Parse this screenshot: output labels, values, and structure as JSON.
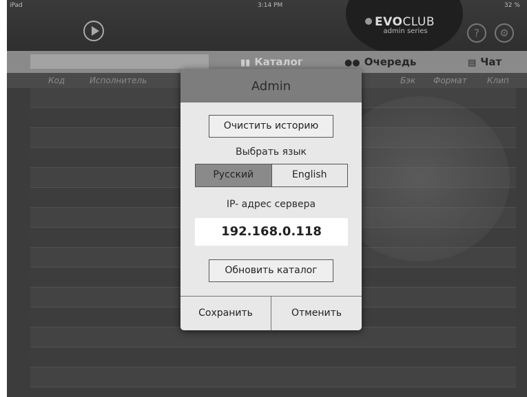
{
  "status": {
    "device": "iPad",
    "time": "3:14 PM",
    "battery": "32 %"
  },
  "logo": {
    "brand_bold": "EVO",
    "brand_light": "CLUB",
    "sub": "admin series"
  },
  "tabs": [
    {
      "label": "Каталог",
      "icon": "book-icon"
    },
    {
      "label": "Очередь",
      "icon": "people-icon"
    },
    {
      "label": "Чат",
      "icon": "chat-icon"
    }
  ],
  "columns": {
    "code": "Код",
    "artist": "Исполнитель",
    "back": "Бэк",
    "format": "Формат",
    "clip": "Клип"
  },
  "dialog": {
    "title": "Admin",
    "clear_history": "Очистить историю",
    "choose_language": "Выбрать язык",
    "lang_ru": "Русский",
    "lang_en": "English",
    "ip_label": "IP- адрес сервера",
    "ip_value": "192.168.0.118",
    "update_catalog": "Обновить каталог",
    "save": "Сохранить",
    "cancel": "Отменить"
  }
}
